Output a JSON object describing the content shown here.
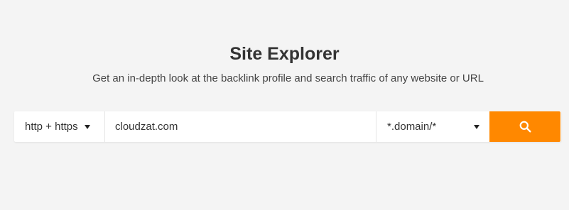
{
  "header": {
    "title": "Site Explorer",
    "subtitle": "Get an in-depth look at the backlink profile and search traffic of any website or URL"
  },
  "search": {
    "protocol_value": "http + https",
    "url_value": "cloudzat.com",
    "mode_value": "*.domain/*",
    "button_icon": "search-icon",
    "button_color": "#ff8800"
  }
}
